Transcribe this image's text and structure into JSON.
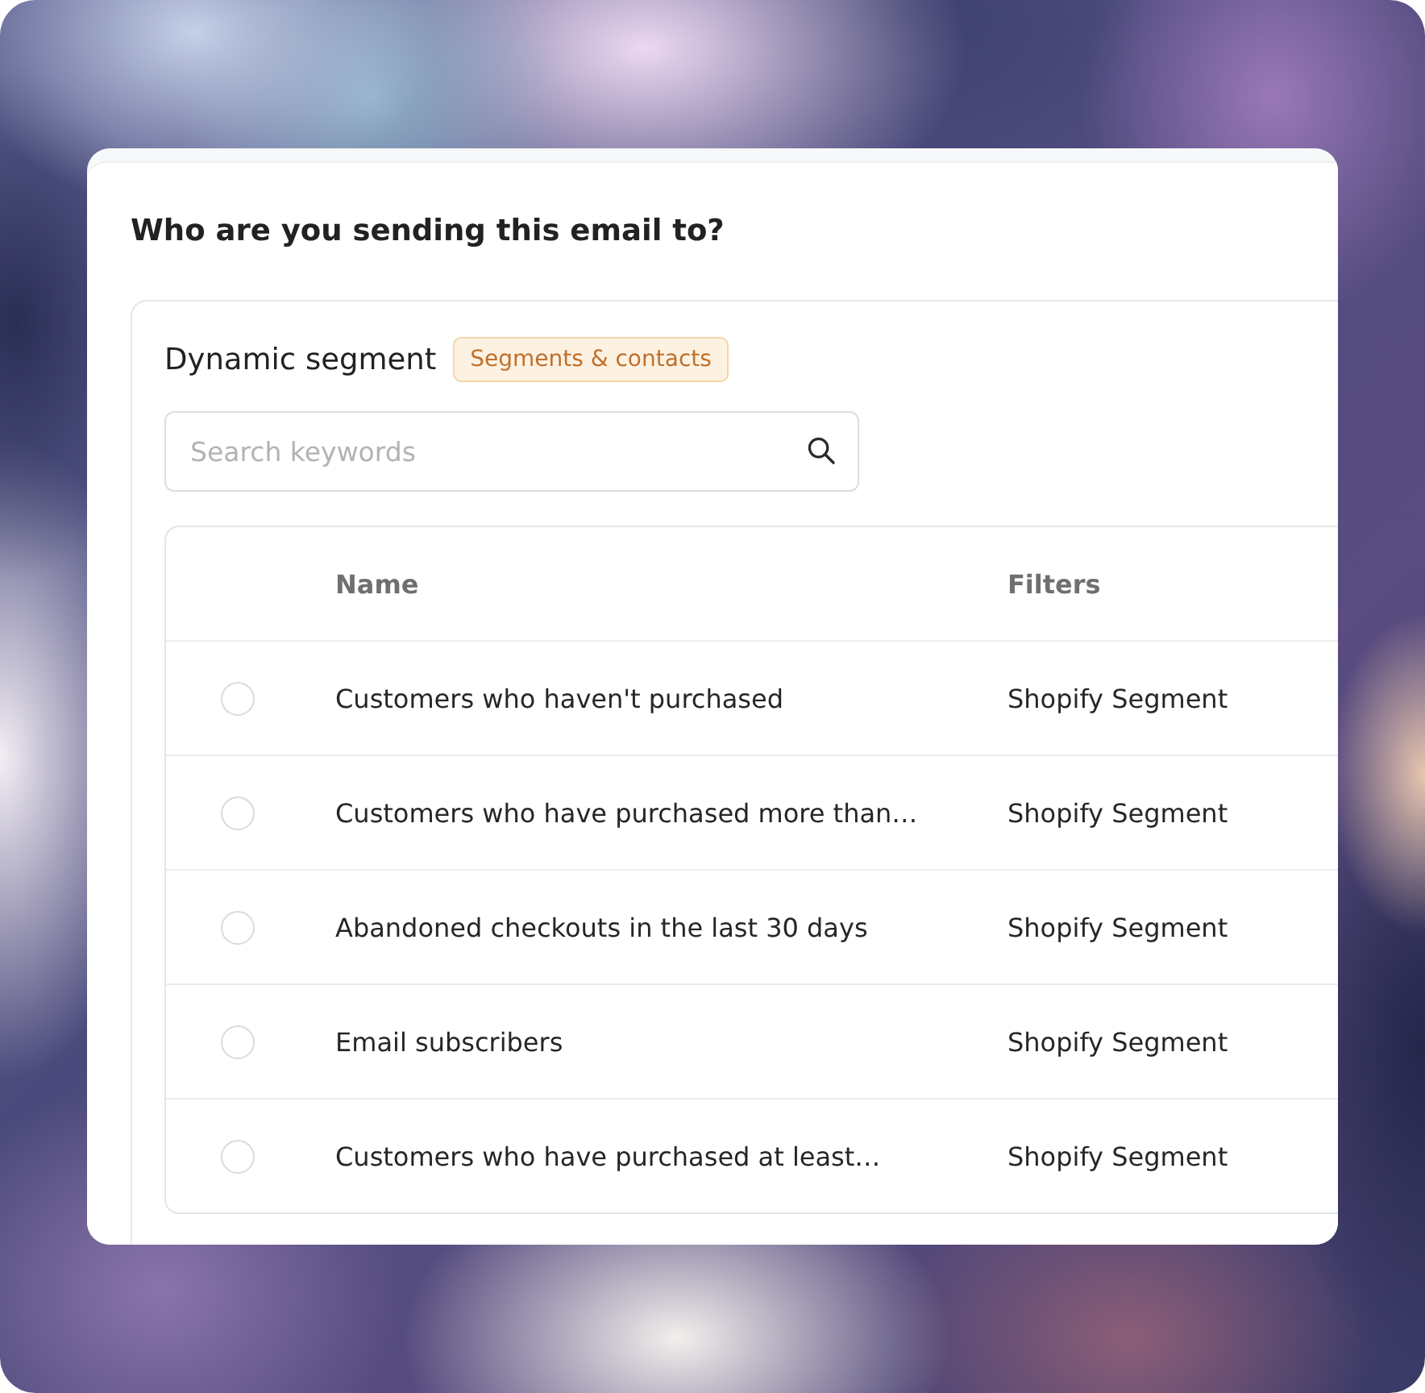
{
  "dialog": {
    "title": "Who are you sending this email to?"
  },
  "segment_panel": {
    "title": "Dynamic segment",
    "badge": "Segments & contacts",
    "search": {
      "placeholder": "Search keywords"
    },
    "table": {
      "columns": [
        "Name",
        "Filters"
      ],
      "rows": [
        {
          "selected": false,
          "name": "Customers who haven't purchased",
          "filters": "Shopify Segment"
        },
        {
          "selected": false,
          "name": "Customers who have purchased more than…",
          "filters": "Shopify Segment"
        },
        {
          "selected": false,
          "name": "Abandoned checkouts in the last 30 days",
          "filters": "Shopify Segment"
        },
        {
          "selected": false,
          "name": "Email subscribers",
          "filters": "Shopify Segment"
        },
        {
          "selected": false,
          "name": "Customers who have purchased at least…",
          "filters": "Shopify Segment"
        }
      ]
    }
  }
}
